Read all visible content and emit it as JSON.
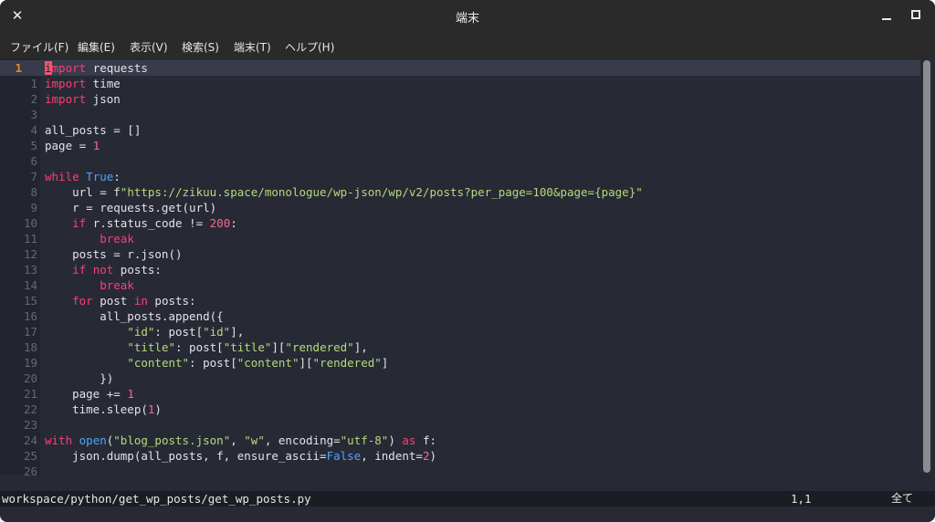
{
  "window": {
    "title": "端末",
    "close_glyph": "✕"
  },
  "menubar": {
    "items": [
      "ファイル(F)",
      "編集(E)",
      "表示(V)",
      "検索(S)",
      "端末(T)",
      "ヘルプ(H)"
    ]
  },
  "editor": {
    "lines": [
      {
        "num": "1",
        "tokens": [
          {
            "t": "i",
            "c": "cursor"
          },
          {
            "t": "mport",
            "c": "k"
          },
          {
            "t": " requests",
            "c": ""
          }
        ]
      },
      {
        "num": "1",
        "tokens": [
          {
            "t": "import",
            "c": "k"
          },
          {
            "t": " time",
            "c": ""
          }
        ]
      },
      {
        "num": "2",
        "tokens": [
          {
            "t": "import",
            "c": "k"
          },
          {
            "t": " json",
            "c": ""
          }
        ]
      },
      {
        "num": "3",
        "tokens": []
      },
      {
        "num": "4",
        "tokens": [
          {
            "t": "all_posts = []",
            "c": ""
          }
        ]
      },
      {
        "num": "5",
        "tokens": [
          {
            "t": "page = ",
            "c": ""
          },
          {
            "t": "1",
            "c": "n"
          }
        ]
      },
      {
        "num": "6",
        "tokens": []
      },
      {
        "num": "7",
        "tokens": [
          {
            "t": "while",
            "c": "k"
          },
          {
            "t": " ",
            "c": ""
          },
          {
            "t": "True",
            "c": "b"
          },
          {
            "t": ":",
            "c": ""
          }
        ]
      },
      {
        "num": "8",
        "tokens": [
          {
            "t": "    url = f",
            "c": ""
          },
          {
            "t": "\"https://zikuu.space/monologue/wp-json/wp/v2/posts?per_page=100&page={page}\"",
            "c": "s"
          }
        ]
      },
      {
        "num": "9",
        "tokens": [
          {
            "t": "    r = requests.get(url)",
            "c": ""
          }
        ]
      },
      {
        "num": "10",
        "tokens": [
          {
            "t": "    ",
            "c": ""
          },
          {
            "t": "if",
            "c": "k"
          },
          {
            "t": " r.status_code != ",
            "c": ""
          },
          {
            "t": "200",
            "c": "n"
          },
          {
            "t": ":",
            "c": ""
          }
        ]
      },
      {
        "num": "11",
        "tokens": [
          {
            "t": "        ",
            "c": ""
          },
          {
            "t": "break",
            "c": "k"
          }
        ]
      },
      {
        "num": "12",
        "tokens": [
          {
            "t": "    posts = r.json()",
            "c": ""
          }
        ]
      },
      {
        "num": "13",
        "tokens": [
          {
            "t": "    ",
            "c": ""
          },
          {
            "t": "if",
            "c": "k"
          },
          {
            "t": " ",
            "c": ""
          },
          {
            "t": "not",
            "c": "k"
          },
          {
            "t": " posts:",
            "c": ""
          }
        ]
      },
      {
        "num": "14",
        "tokens": [
          {
            "t": "        ",
            "c": ""
          },
          {
            "t": "break",
            "c": "k"
          }
        ]
      },
      {
        "num": "15",
        "tokens": [
          {
            "t": "    ",
            "c": ""
          },
          {
            "t": "for",
            "c": "k"
          },
          {
            "t": " post ",
            "c": ""
          },
          {
            "t": "in",
            "c": "k"
          },
          {
            "t": " posts:",
            "c": ""
          }
        ]
      },
      {
        "num": "16",
        "tokens": [
          {
            "t": "        all_posts.append({",
            "c": ""
          }
        ]
      },
      {
        "num": "17",
        "tokens": [
          {
            "t": "            ",
            "c": ""
          },
          {
            "t": "\"id\"",
            "c": "s"
          },
          {
            "t": ": post[",
            "c": ""
          },
          {
            "t": "\"id\"",
            "c": "s"
          },
          {
            "t": "],",
            "c": ""
          }
        ]
      },
      {
        "num": "18",
        "tokens": [
          {
            "t": "            ",
            "c": ""
          },
          {
            "t": "\"title\"",
            "c": "s"
          },
          {
            "t": ": post[",
            "c": ""
          },
          {
            "t": "\"title\"",
            "c": "s"
          },
          {
            "t": "][",
            "c": ""
          },
          {
            "t": "\"rendered\"",
            "c": "s"
          },
          {
            "t": "],",
            "c": ""
          }
        ]
      },
      {
        "num": "19",
        "tokens": [
          {
            "t": "            ",
            "c": ""
          },
          {
            "t": "\"content\"",
            "c": "s"
          },
          {
            "t": ": post[",
            "c": ""
          },
          {
            "t": "\"content\"",
            "c": "s"
          },
          {
            "t": "][",
            "c": ""
          },
          {
            "t": "\"rendered\"",
            "c": "s"
          },
          {
            "t": "]",
            "c": ""
          }
        ]
      },
      {
        "num": "20",
        "tokens": [
          {
            "t": "        })",
            "c": ""
          }
        ]
      },
      {
        "num": "21",
        "tokens": [
          {
            "t": "    page += ",
            "c": ""
          },
          {
            "t": "1",
            "c": "n"
          }
        ]
      },
      {
        "num": "22",
        "tokens": [
          {
            "t": "    time.sleep(",
            "c": ""
          },
          {
            "t": "1",
            "c": "n"
          },
          {
            "t": ")",
            "c": ""
          }
        ]
      },
      {
        "num": "23",
        "tokens": []
      },
      {
        "num": "24",
        "tokens": [
          {
            "t": "with",
            "c": "k"
          },
          {
            "t": " ",
            "c": ""
          },
          {
            "t": "open",
            "c": "b"
          },
          {
            "t": "(",
            "c": ""
          },
          {
            "t": "\"blog_posts.json\"",
            "c": "s"
          },
          {
            "t": ", ",
            "c": ""
          },
          {
            "t": "\"w\"",
            "c": "s"
          },
          {
            "t": ", encoding=",
            "c": ""
          },
          {
            "t": "\"utf-8\"",
            "c": "s"
          },
          {
            "t": ") ",
            "c": ""
          },
          {
            "t": "as",
            "c": "k"
          },
          {
            "t": " f:",
            "c": ""
          }
        ]
      },
      {
        "num": "25",
        "tokens": [
          {
            "t": "    json.dump(all_posts, f, ensure_ascii=",
            "c": ""
          },
          {
            "t": "False",
            "c": "b"
          },
          {
            "t": ", indent=",
            "c": ""
          },
          {
            "t": "2",
            "c": "n"
          },
          {
            "t": ")",
            "c": ""
          }
        ]
      },
      {
        "num": "26",
        "tokens": []
      }
    ]
  },
  "statusbar": {
    "path": "workspace/python/get_wp_posts/get_wp_posts.py",
    "position": "1,1",
    "scroll": "全て"
  },
  "colors": {
    "keyword": "#ff3d73",
    "builtin": "#4fa3ff",
    "string": "#b7d97b",
    "number": "#ff6688",
    "current_line_number": "#e88a2a",
    "editor_bg": "#272a35"
  }
}
